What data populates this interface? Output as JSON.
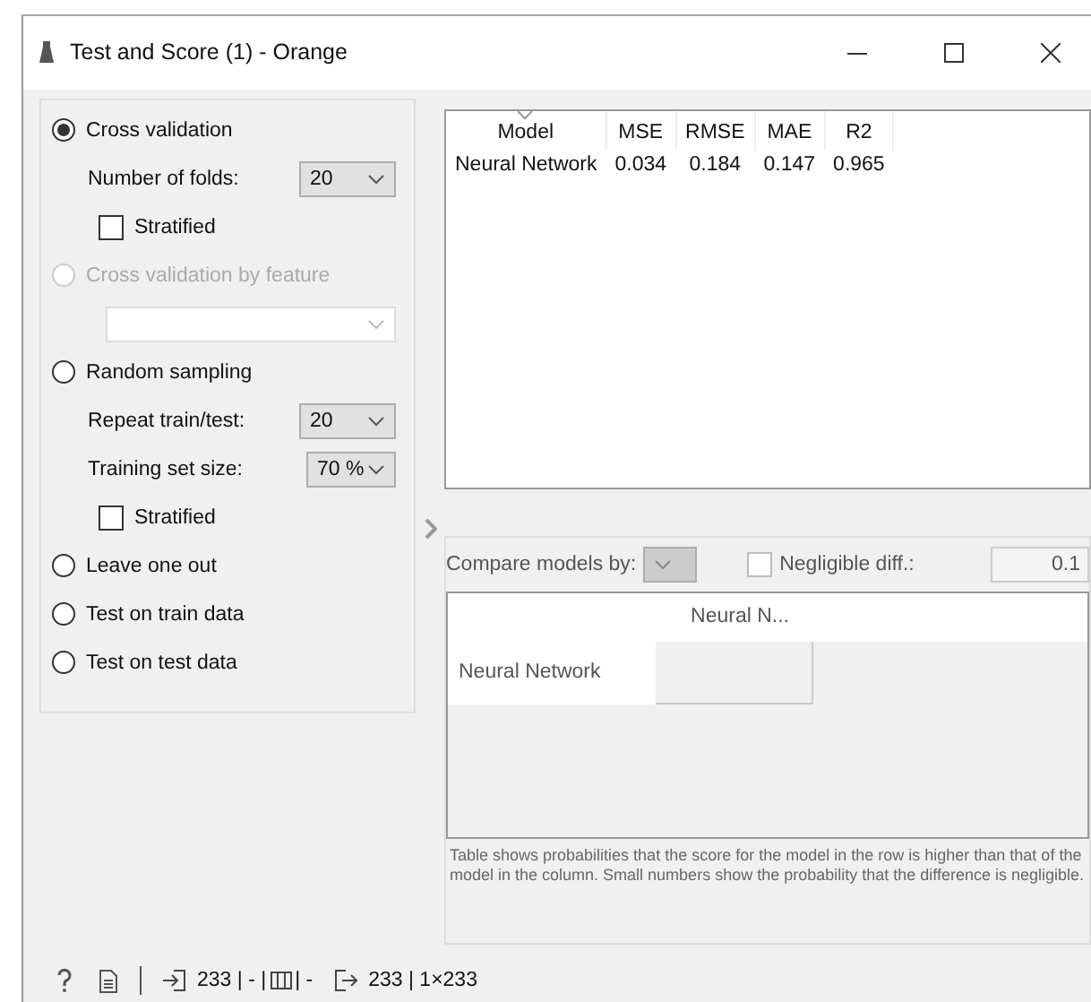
{
  "window": {
    "title": "Test and Score (1) - Orange"
  },
  "sampling": [
    {
      "kind": "radio",
      "label": "Cross validation",
      "selected": true,
      "disabled": false
    },
    {
      "kind": "combo",
      "label": "Number of folds:",
      "value": "20",
      "disabled": false
    },
    {
      "kind": "checkbox",
      "label": "Stratified",
      "checked": false
    },
    {
      "kind": "radio",
      "label": "Cross validation by feature",
      "selected": false,
      "disabled": true
    },
    {
      "kind": "combo",
      "disabled": true
    },
    {
      "kind": "radio",
      "label": "Random sampling",
      "selected": false,
      "disabled": false
    },
    {
      "kind": "combo",
      "label": "Repeat train/test:",
      "value": "20",
      "disabled": false
    },
    {
      "kind": "combo",
      "label": "Training set size:",
      "value": "70 %",
      "disabled": false
    },
    {
      "kind": "checkbox",
      "label": "Stratified",
      "checked": false
    },
    {
      "kind": "radio",
      "label": "Leave one out",
      "selected": false,
      "disabled": false
    },
    {
      "kind": "radio",
      "label": "Test on train data",
      "selected": false,
      "disabled": false
    },
    {
      "kind": "radio",
      "label": "Test on test data",
      "selected": false,
      "disabled": false
    }
  ],
  "results": {
    "columns": [
      {
        "label": "Model",
        "sorted": true
      },
      {
        "label": "MSE",
        "sorted": false
      },
      {
        "label": "RMSE",
        "sorted": false
      },
      {
        "label": "MAE",
        "sorted": false
      },
      {
        "label": "R2",
        "sorted": false
      }
    ],
    "rows": [
      [
        "Neural Network",
        "0.034",
        "0.184",
        "0.147",
        "0.965"
      ]
    ]
  },
  "compare": {
    "label": "Compare models by:",
    "combo_disabled": true,
    "negligible": {
      "label": "Negligible diff.:",
      "checked": false,
      "value": "0.1"
    },
    "column_headers": [
      "Neural N..."
    ],
    "row_headers": [
      "Neural Network"
    ],
    "note": "Table shows probabilities that the score for the model in the row is higher than that of the model in the column. Small numbers show the probability that the difference is negligible."
  },
  "status_bar": {
    "input": "233",
    "input_rest": "| - |",
    "middle": "| -",
    "output": "233 | 1×233"
  }
}
